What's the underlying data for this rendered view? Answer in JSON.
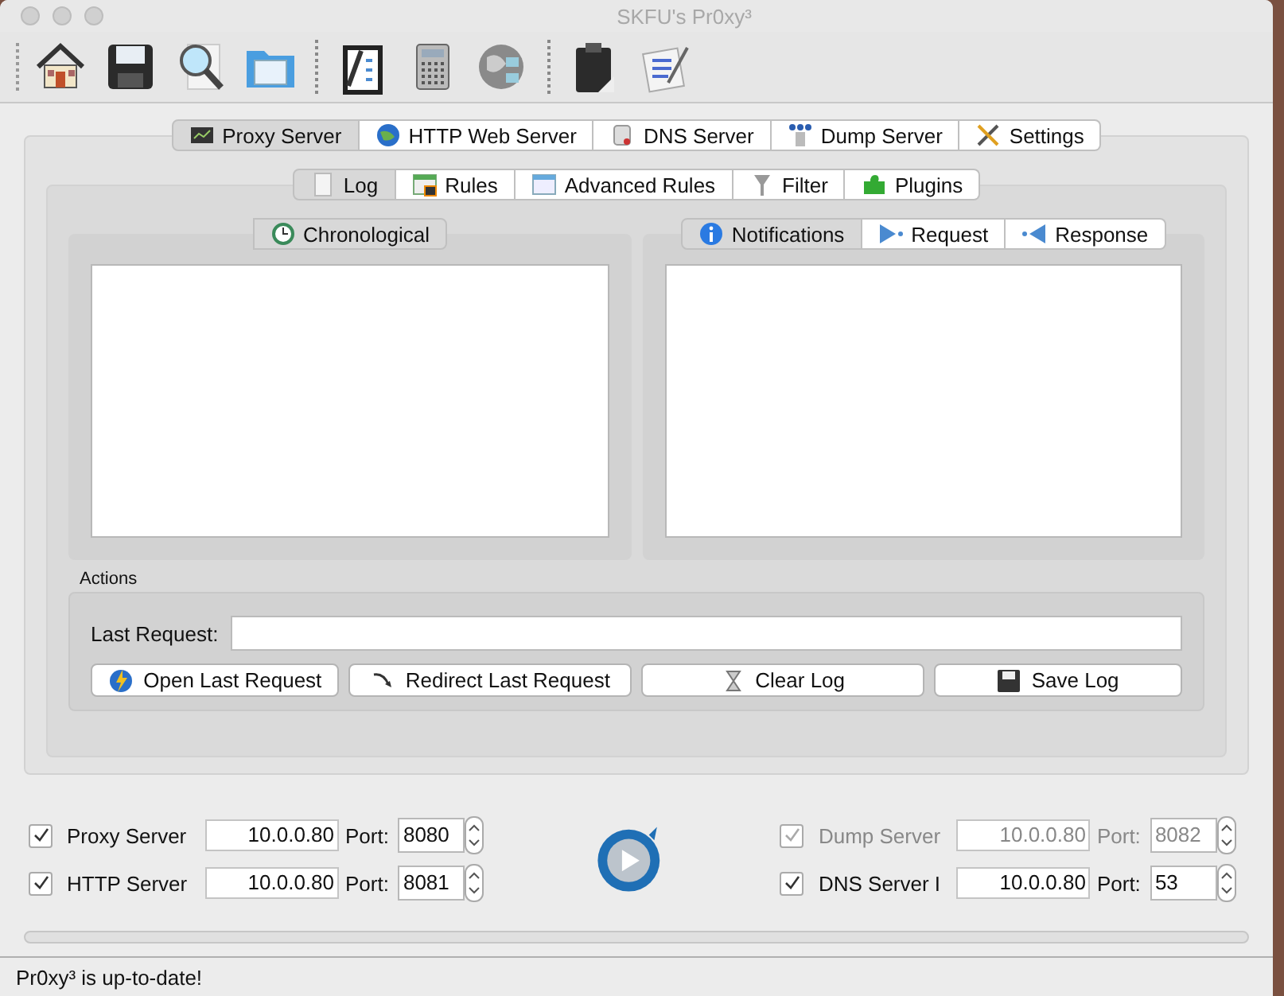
{
  "window": {
    "title": "SKFU's Pr0xy³"
  },
  "main_tabs": [
    {
      "label": "Proxy Server",
      "selected": true
    },
    {
      "label": "HTTP Web Server",
      "selected": false
    },
    {
      "label": "DNS Server",
      "selected": false
    },
    {
      "label": "Dump Server",
      "selected": false
    },
    {
      "label": "Settings",
      "selected": false
    }
  ],
  "sub_tabs": [
    {
      "label": "Log",
      "selected": true
    },
    {
      "label": "Rules",
      "selected": false
    },
    {
      "label": "Advanced Rules",
      "selected": false
    },
    {
      "label": "Filter",
      "selected": false
    },
    {
      "label": "Plugins",
      "selected": false
    }
  ],
  "left_pane": {
    "tabs": [
      {
        "label": "Chronological",
        "selected": true
      }
    ]
  },
  "right_pane": {
    "tabs": [
      {
        "label": "Notifications",
        "selected": true
      },
      {
        "label": "Request",
        "selected": false
      },
      {
        "label": "Response",
        "selected": false
      }
    ]
  },
  "actions": {
    "title": "Actions",
    "last_request_label": "Last Request:",
    "buttons": [
      "Open Last Request",
      "Redirect Last Request",
      "Clear Log",
      "Save Log"
    ]
  },
  "servers_left": [
    {
      "label": "Proxy Server",
      "checked": true,
      "disabled": false,
      "address": "10.0.0.80",
      "port_label": "Port:",
      "port": "8080"
    },
    {
      "label": "HTTP Server",
      "checked": true,
      "disabled": false,
      "address": "10.0.0.80",
      "port_label": "Port:",
      "port": "8081"
    }
  ],
  "servers_right": [
    {
      "label": "Dump Server",
      "checked": true,
      "disabled": true,
      "address": "10.0.0.80",
      "port_label": "Port:",
      "port": "8082"
    },
    {
      "label": "DNS Server I",
      "checked": true,
      "disabled": false,
      "address": "10.0.0.80",
      "port_label": "Port:",
      "port": "53"
    }
  ],
  "progress": {
    "level": 0
  },
  "status_bar": "Pr0xy³ is up-to-date!"
}
